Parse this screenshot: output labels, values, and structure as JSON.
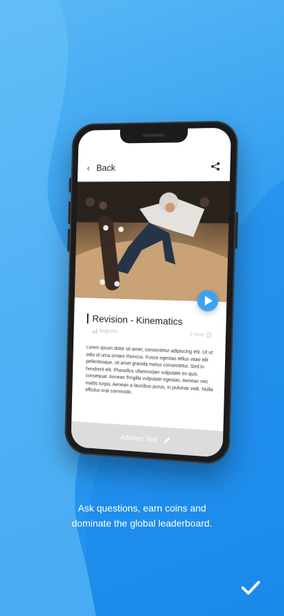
{
  "app": {
    "back_label": "Back",
    "title": "Revision - Kinematics",
    "meta_left": "Beginner",
    "meta_right": "2 mins",
    "body": "Lorem ipsum dolor sit amet, consectetur adipiscing elit. Ut ut odio id urna ornare rhoncus. Fusce egestas tellus vitae elit pellentesque, sit amet gravida metus consectetur. Sed in hendrerit elit. Phasellus ullamcorper vulputate ex quis consequat. Aenean fringilla vulputate egestas. Aenean nec mattis turpis. Aenean a faucibus purus, in pulvinar velit. Nulla efficitur erat commodo.",
    "attempt_label": "Attempt Test"
  },
  "caption": {
    "line1": "Ask questions, earn coins and",
    "line2": "dominate the global leaderboard."
  },
  "colors": {
    "background": "#2f9cf0",
    "accent": "#3aa3f0",
    "attempt_bg": "#dcdcdc"
  },
  "icons": [
    "back-chevron-icon",
    "share-icon",
    "play-icon",
    "level-bars-icon",
    "clock-icon",
    "pen-icon",
    "checkmark-icon"
  ]
}
